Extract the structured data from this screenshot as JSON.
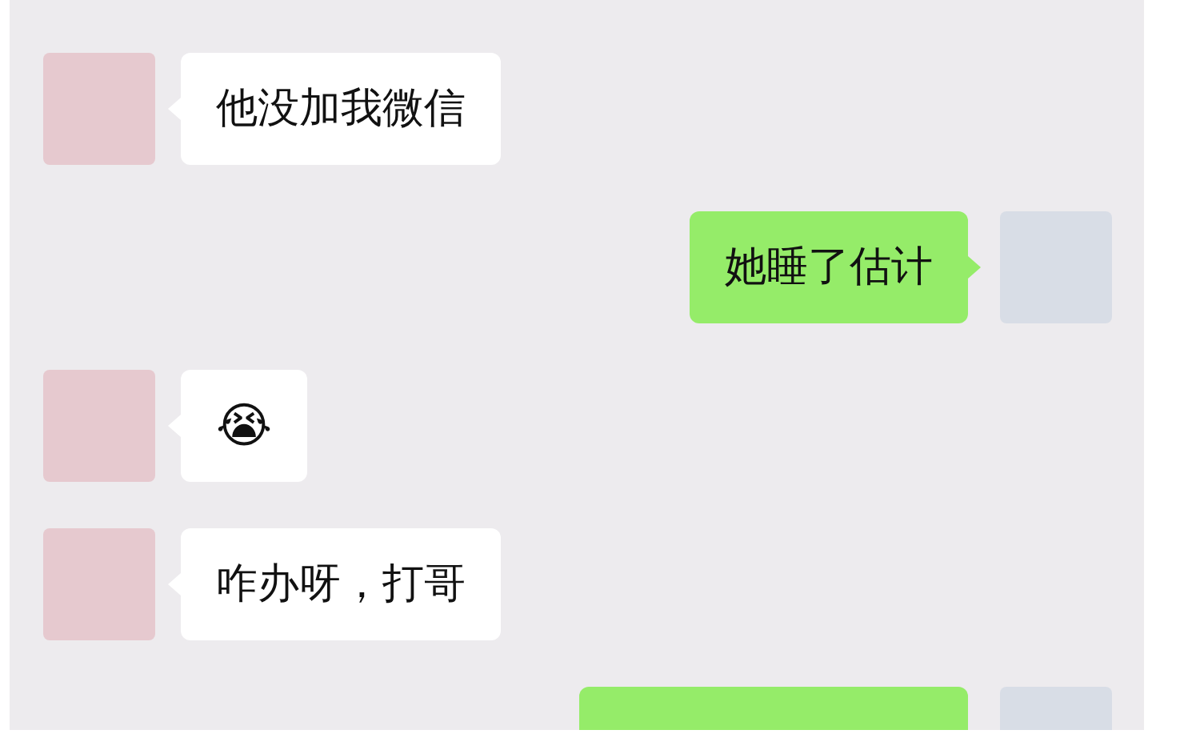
{
  "messages": [
    {
      "outgoing": false,
      "kind": "text",
      "text": "他没加我微信"
    },
    {
      "outgoing": true,
      "kind": "text",
      "text": "她睡了估计"
    },
    {
      "outgoing": false,
      "kind": "emoji",
      "text": "😭"
    },
    {
      "outgoing": false,
      "kind": "text",
      "text": "咋办呀，打哥"
    },
    {
      "outgoing": true,
      "kind": "cut"
    }
  ]
}
